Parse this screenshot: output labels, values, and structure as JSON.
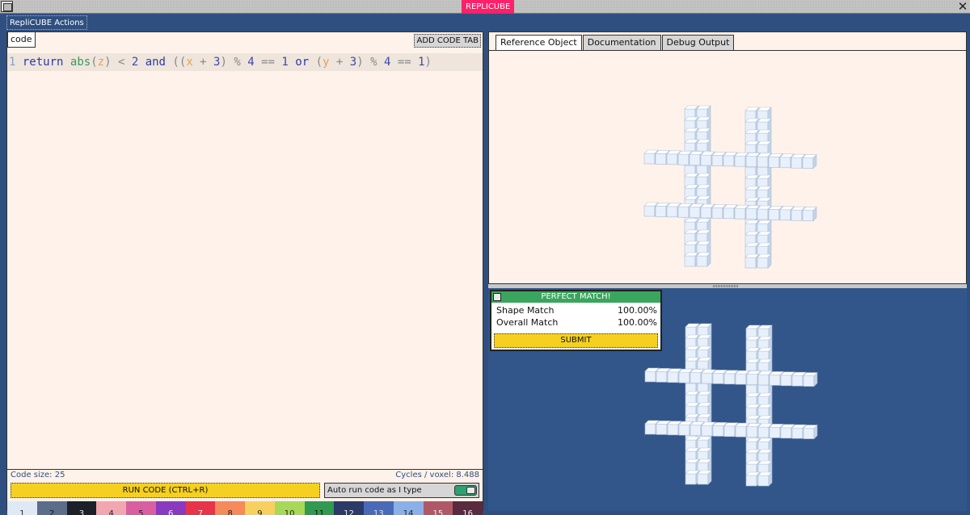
{
  "window": {
    "title": "REPLICUBE"
  },
  "actions_menu": {
    "label": "RepliCUBE Actions"
  },
  "editor": {
    "tab_label": "code",
    "add_tab_label": "ADD CODE TAB",
    "line_number": "1",
    "tokens": {
      "return": "return",
      "abs": "abs",
      "lp": "(",
      "z": "z",
      "rp": ")",
      "lt": "<",
      "two": "2",
      "and": "and",
      "lp2": "((",
      "x": "x",
      "plus": "+",
      "three": "3",
      "mod": "%",
      "four": "4",
      "eq": "==",
      "one": "1",
      "or": "or",
      "y": "y"
    },
    "code_size": "Code size: 25",
    "cycles": "Cycles / voxel: 8.488",
    "run_label": "RUN CODE (CTRL+R)",
    "autorun_label": "Auto run code as I type",
    "autorun_enabled": true
  },
  "palette": [
    {
      "label": "1",
      "color": "#dfe9f5",
      "text": "#222"
    },
    {
      "label": "2",
      "color": "#5c6d8a",
      "text": "#111"
    },
    {
      "label": "3",
      "color": "#1c2028",
      "text": "#eee"
    },
    {
      "label": "4",
      "color": "#f2a6b0",
      "text": "#222"
    },
    {
      "label": "5",
      "color": "#d860a0",
      "text": "#222"
    },
    {
      "label": "6",
      "color": "#8a3ac0",
      "text": "#eee"
    },
    {
      "label": "7",
      "color": "#e8344a",
      "text": "#eee"
    },
    {
      "label": "8",
      "color": "#f58a5a",
      "text": "#222"
    },
    {
      "label": "9",
      "color": "#f7d060",
      "text": "#222"
    },
    {
      "label": "10",
      "color": "#a8d858",
      "text": "#222"
    },
    {
      "label": "11",
      "color": "#2f9a50",
      "text": "#111"
    },
    {
      "label": "12",
      "color": "#2c3a68",
      "text": "#eee"
    },
    {
      "label": "13",
      "color": "#4a6ab8",
      "text": "#dde"
    },
    {
      "label": "14",
      "color": "#8ab0e8",
      "text": "#222"
    },
    {
      "label": "15",
      "color": "#b05868",
      "text": "#eee"
    },
    {
      "label": "16",
      "color": "#5a2a40",
      "text": "#eee"
    }
  ],
  "right_tabs": [
    {
      "label": "Reference Object",
      "active": true
    },
    {
      "label": "Documentation",
      "active": false
    },
    {
      "label": "Debug Output",
      "active": false
    }
  ],
  "match": {
    "header": "PERFECT MATCH!",
    "shape_label": "Shape Match",
    "shape_value": "100.00%",
    "overall_label": "Overall Match",
    "overall_value": "100.00%",
    "submit_label": "SUBMIT"
  },
  "colors": {
    "frame_blue": "#2f4f80",
    "editor_bg": "#fff2ea",
    "accent_yellow": "#f5d020",
    "match_green": "#3aa55e",
    "title_pink": "#ff1f6a"
  }
}
